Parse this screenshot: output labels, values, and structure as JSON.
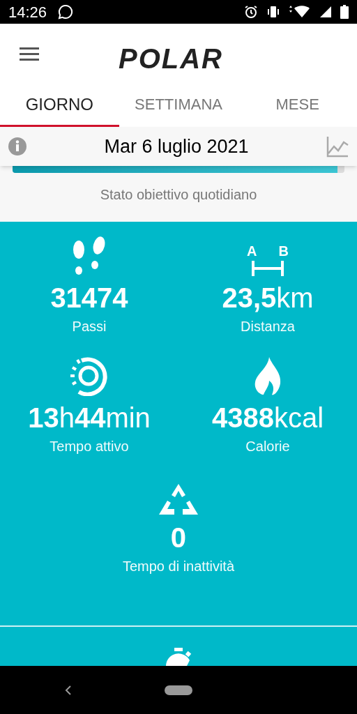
{
  "status_bar": {
    "time": "14:26"
  },
  "header": {
    "logo": "POLAR"
  },
  "tabs": [
    {
      "label": "GIORNO",
      "selected": true
    },
    {
      "label": "SETTIMANA",
      "selected": false
    },
    {
      "label": "MESE",
      "selected": false
    }
  ],
  "date_bar": {
    "date": "Mar 6 luglio 2021"
  },
  "goal": {
    "level": 0.98,
    "label": "Stato obiettivo quotidiano"
  },
  "metrics": [
    {
      "kind": "steps",
      "value": "**31474**",
      "label": "Passi"
    },
    {
      "kind": "distance",
      "icon_labels": [
        "A",
        "B"
      ],
      "value": "**23,5**km",
      "label": "Distanza"
    },
    {
      "kind": "active",
      "value": "**13**h**44**min",
      "label": "Tempo attivo"
    },
    {
      "kind": "calories",
      "value": "**4388**kcal",
      "label": "Calorie"
    },
    {
      "kind": "inactivity",
      "value": "**0**",
      "label": "Tempo di inattività"
    }
  ],
  "next_section": {
    "kind": "stopwatch"
  }
}
